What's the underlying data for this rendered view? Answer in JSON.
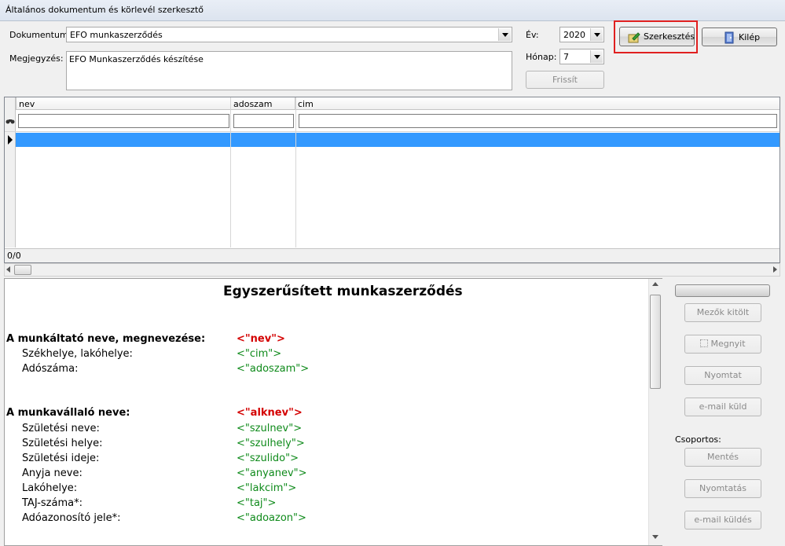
{
  "window": {
    "title": "Általános dokumentum és körlevél szerkesztő"
  },
  "form": {
    "dokumentum_label": "Dokumentum:",
    "dokumentum_value": "EFO munkaszerződés",
    "megjegyzes_label": "Megjegyzés:",
    "megjegyzes_value": "EFO Munkaszerződés készítése",
    "ev_label": "Év:",
    "ev_value": "2020",
    "honap_label": "Hónap:",
    "honap_value": "7",
    "frissit_label": "Frissít",
    "szerkesztes_label": "Szerkesztés",
    "kilep_label": "Kilép",
    "highlight_color": "#e02020"
  },
  "grid": {
    "columns": [
      "nev",
      "adoszam",
      "cim"
    ],
    "status": "0/0",
    "selection_color": "#3399ff"
  },
  "document": {
    "title": "Egyszerűsített munkaszerződés",
    "sections": [
      {
        "label": "A munkáltató neve, megnevezése:",
        "field": "<\"nev\">",
        "bold": true
      },
      {
        "label": "Székhelye, lakóhelye:",
        "field": "<\"cim\">",
        "bold": false
      },
      {
        "label": "Adószáma:",
        "field": "<\"adoszam\">",
        "bold": false
      },
      {
        "label": "A munkavállaló neve:",
        "field": "<\"alknev\">",
        "bold": true
      },
      {
        "label": "Születési neve:",
        "field": "<\"szulnev\">",
        "bold": false
      },
      {
        "label": "Születési helye:",
        "field": "<\"szulhely\">",
        "bold": false
      },
      {
        "label": "Születési ideje:",
        "field": "<\"szulido\">",
        "bold": false
      },
      {
        "label": "Anyja neve:",
        "field": "<\"anyanev\">",
        "bold": false
      },
      {
        "label": "Lakóhelye:",
        "field": "<\"lakcim\">",
        "bold": false
      },
      {
        "label": "TAJ-száma*:",
        "field": "<\"taj\">",
        "bold": false
      },
      {
        "label": "Adóazonosító jele*:",
        "field": "<\"adoazon\">",
        "bold": false
      }
    ]
  },
  "side": {
    "mezok_kitolt": "Mezők kitölt",
    "megnyit": "Megnyit",
    "nyomtat": "Nyomtat",
    "email_kuld": "e-mail küld",
    "csoportos_label": "Csoportos:",
    "mentes": "Mentés",
    "nyomtatas": "Nyomtatás",
    "email_kuldes": "e-mail küldés"
  }
}
